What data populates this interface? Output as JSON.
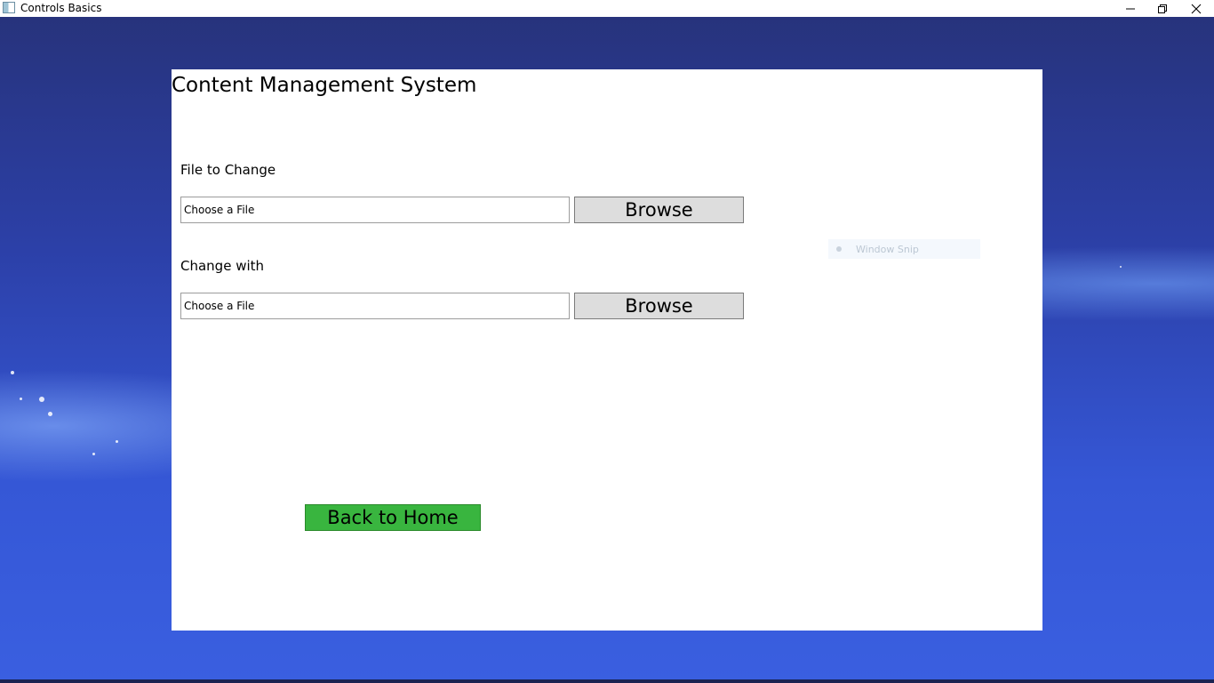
{
  "window": {
    "title": "Controls Basics",
    "controls": {
      "minimize_icon": "minimize-icon",
      "maximize_icon": "restore-icon",
      "close_icon": "close-icon"
    }
  },
  "page": {
    "title": "Content Management System"
  },
  "form": {
    "file_to_change": {
      "label": "File to Change",
      "input_placeholder": "Choose a File",
      "browse_label": "Browse"
    },
    "change_with": {
      "label": "Change with",
      "input_placeholder": "Choose a File",
      "browse_label": "Browse"
    }
  },
  "actions": {
    "back_home_label": "Back to Home"
  },
  "overlay": {
    "text": "Window Snip"
  },
  "colors": {
    "desktop_background": "#2c40a8",
    "panel_background": "#ffffff",
    "browse_button": "#dddddd",
    "home_button": "#39b53f"
  }
}
